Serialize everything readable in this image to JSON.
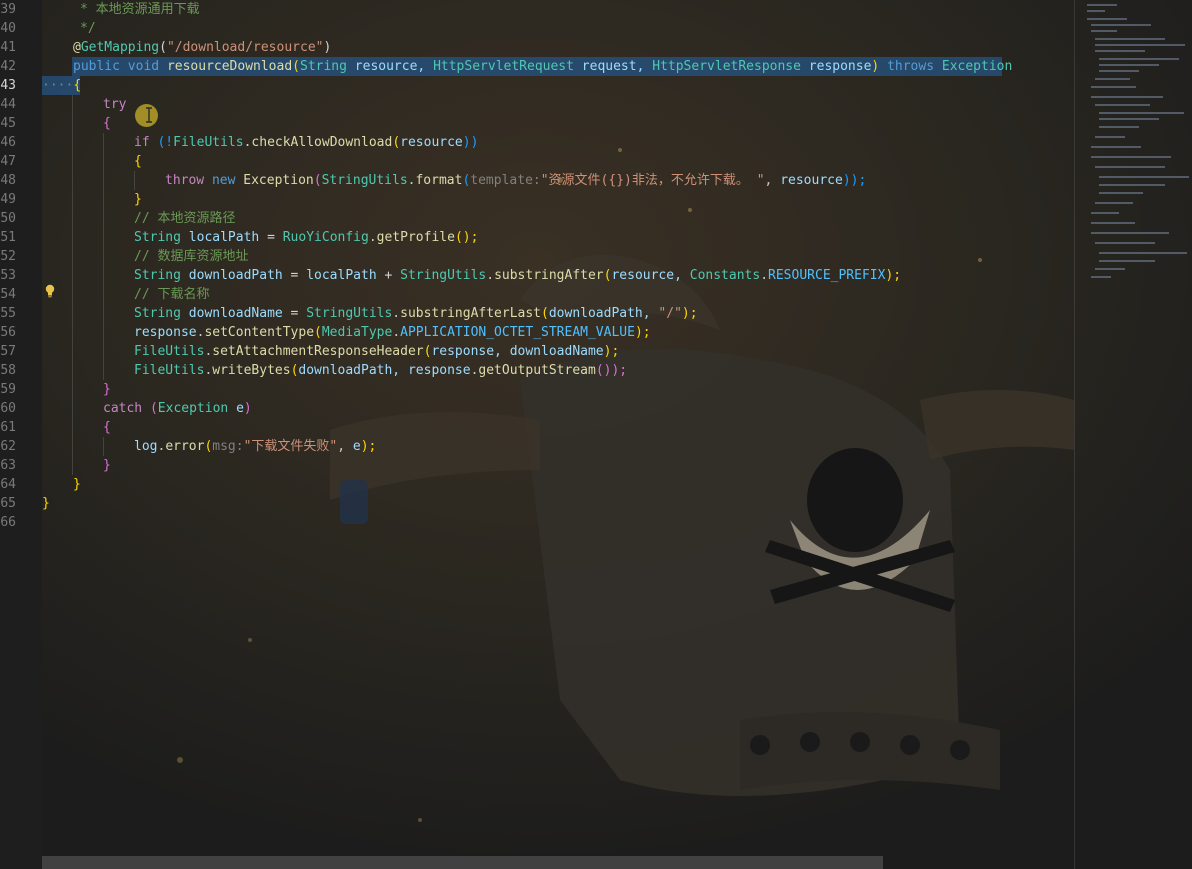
{
  "editor": {
    "active_line": "43",
    "line_numbers": [
      "39",
      "40",
      "41",
      "42",
      "43",
      "44",
      "45",
      "46",
      "47",
      "48",
      "49",
      "50",
      "51",
      "52",
      "53",
      "54",
      "55",
      "56",
      "57",
      "58",
      "59",
      "60",
      "61",
      "62",
      "63",
      "64",
      "65",
      "66"
    ],
    "code": {
      "l39": "* 本地资源通用下载",
      "l40": "*/",
      "l41_at": "@",
      "l41_ann": "GetMapping",
      "l41_open": "(",
      "l41_str": "\"/download/resource\"",
      "l41_close": ")",
      "l42_public": "public",
      "l42_void": "void",
      "l42_name": "resourceDownload",
      "l42_p1type": "String",
      "l42_p1": "resource,",
      "l42_p2type": "HttpServletRequest",
      "l42_p2": "request,",
      "l42_p3type": "HttpServletResponse",
      "l42_p3": "response",
      "l42_throws": "throws",
      "l42_exc": "Exception",
      "l43_dots": "····",
      "l43_brace": "{",
      "l44_try": "try",
      "l45_brace": "{",
      "l46_if": "if",
      "l46_not": "(!",
      "l46_cls": "FileUtils",
      "l46_dot": ".",
      "l46_fn": "checkAllowDownload",
      "l46_p": "(",
      "l46_arg": "resource",
      "l46_end": "))",
      "l47_brace": "{",
      "l48_throw": "throw",
      "l48_new": "new",
      "l48_exc": "Exception",
      "l48_open": "(",
      "l48_cls": "StringUtils",
      "l48_fn": "format",
      "l48_hint": "template:",
      "l48_str": "\"资源文件({})非法，不允许下载。 \"",
      "l48_arg": "resource",
      "l48_end": "));",
      "l49_brace": "}",
      "l50_cmt": "// 本地资源路径",
      "l51_type": "String",
      "l51_var": "localPath",
      "l51_eq": "=",
      "l51_cls": "RuoYiConfig",
      "l51_fn": "getProfile",
      "l51_end": "();",
      "l52_cmt": "// 数据库资源地址",
      "l53_type": "String",
      "l53_var": "downloadPath",
      "l53_eq": "=",
      "l53_lp": "localPath",
      "l53_plus": "+",
      "l53_cls": "StringUtils",
      "l53_fn": "substringAfter",
      "l53_arg": "resource,",
      "l53_cls2": "Constants",
      "l53_const": "RESOURCE_PREFIX",
      "l53_end": ");",
      "l54_cmt": "// 下载名称",
      "l55_type": "String",
      "l55_var": "downloadName",
      "l55_eq": "=",
      "l55_cls": "StringUtils",
      "l55_fn": "substringAfterLast",
      "l55_arg": "downloadPath,",
      "l55_str": "\"/\"",
      "l55_end": ");",
      "l56_obj": "response",
      "l56_fn": "setContentType",
      "l56_cls": "MediaType",
      "l56_const": "APPLICATION_OCTET_STREAM_VALUE",
      "l56_end": ");",
      "l57_cls": "FileUtils",
      "l57_fn": "setAttachmentResponseHeader",
      "l57_arg": "response, downloadName",
      "l57_end": ");",
      "l58_cls": "FileUtils",
      "l58_fn": "writeBytes",
      "l58_arg": "downloadPath, response",
      "l58_fn2": "getOutputStream",
      "l58_end": "());",
      "l59_brace": "}",
      "l60_catch": "catch",
      "l60_exc": "Exception",
      "l60_var": "e",
      "l61_brace": "{",
      "l62_obj": "log",
      "l62_fn": "error",
      "l62_hint": "msg:",
      "l62_str": "\"下载文件失败\"",
      "l62_arg": "e",
      "l62_end": ");",
      "l63_brace": "}",
      "l64_brace": "}",
      "l65_brace": "}"
    }
  },
  "icons": {
    "bulb": "lightbulb-icon"
  },
  "colors": {
    "selection": "#264f78",
    "keyword": "#569cd6",
    "type": "#4ec9b0",
    "function": "#dcdcaa",
    "string": "#ce9178",
    "comment": "#6a9955"
  }
}
